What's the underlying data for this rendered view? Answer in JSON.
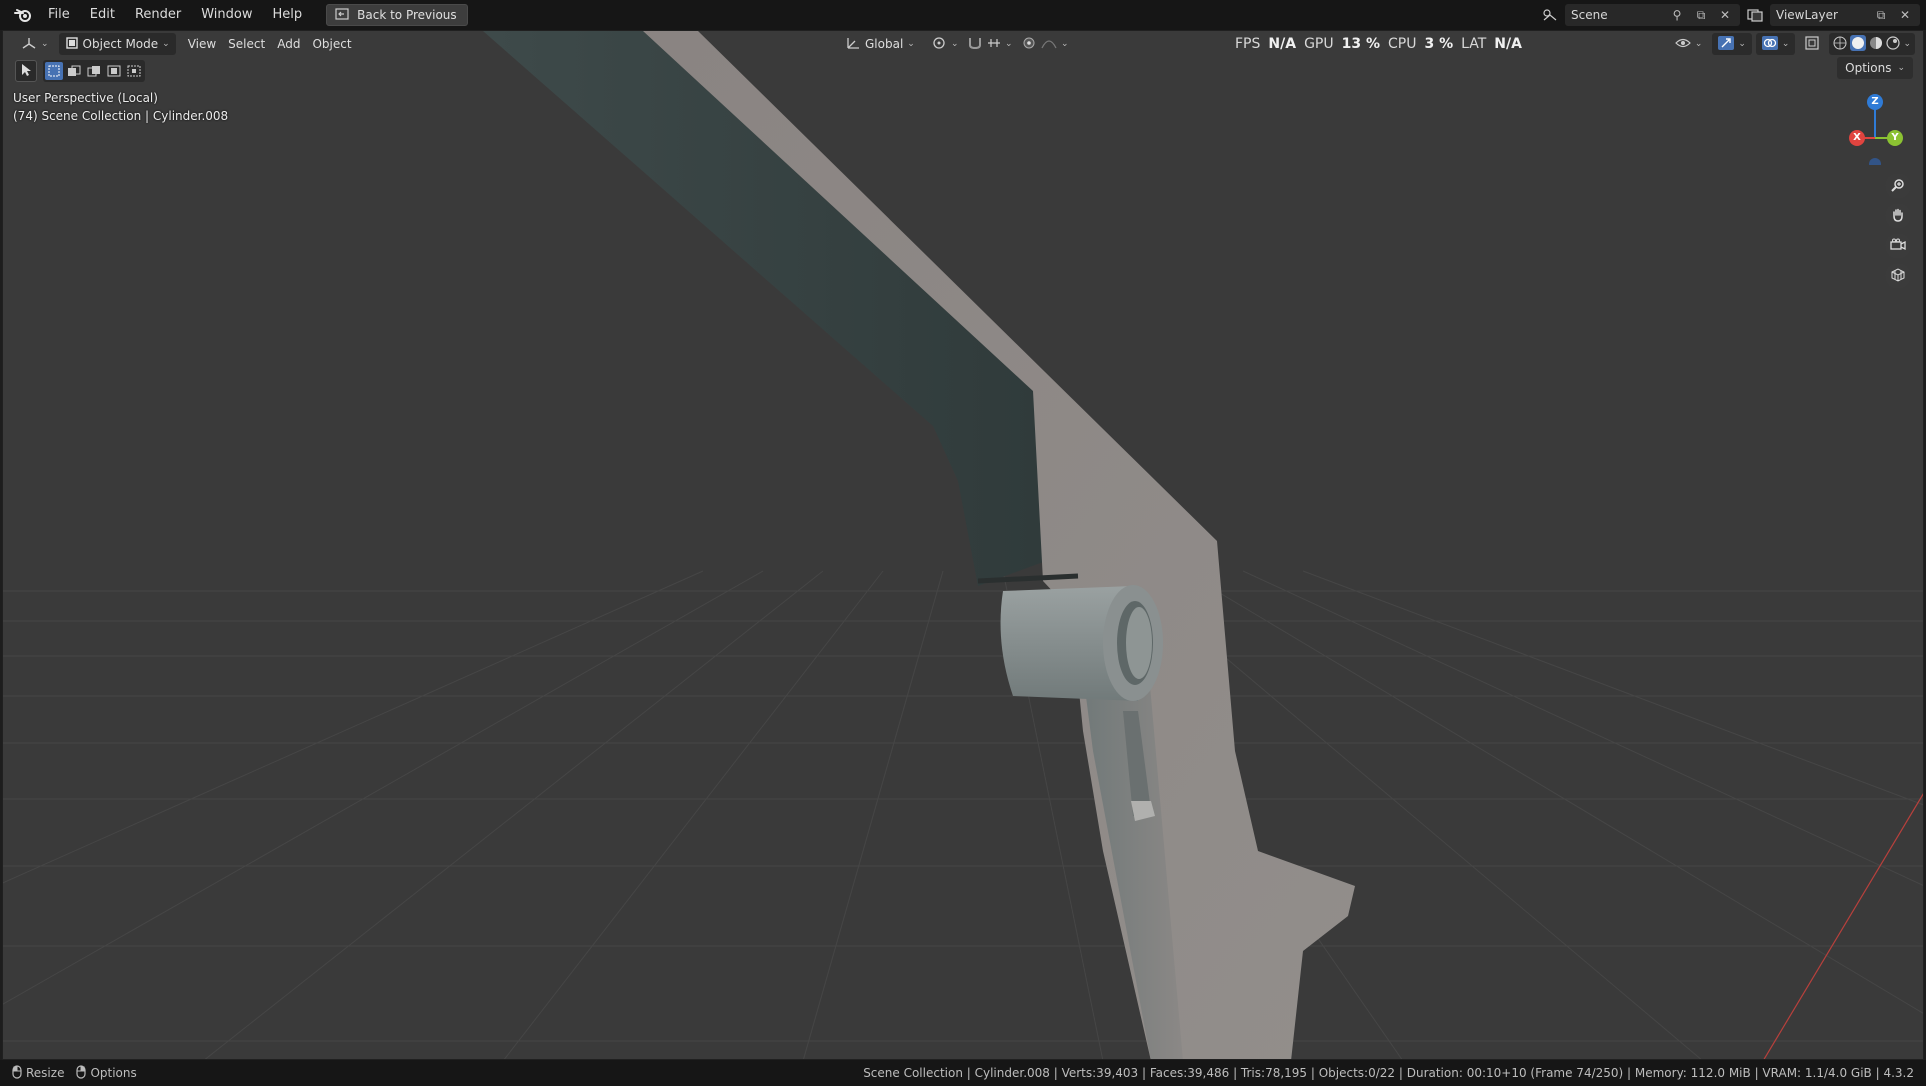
{
  "menu": {
    "items": [
      "File",
      "Edit",
      "Render",
      "Window",
      "Help"
    ],
    "back_button": "Back to Previous"
  },
  "scene": {
    "label": "Scene"
  },
  "view_layer": {
    "label": "ViewLayer"
  },
  "viewport_header": {
    "mode": "Object Mode",
    "menus": [
      "View",
      "Select",
      "Add",
      "Object"
    ],
    "orientation": "Global",
    "options_label": "Options"
  },
  "perf": {
    "fps_label": "FPS",
    "fps_value": "N/A",
    "gpu_label": "GPU",
    "gpu_value": "13 %",
    "cpu_label": "CPU",
    "cpu_value": "3 %",
    "lat_label": "LAT",
    "lat_value": "N/A"
  },
  "overlay": {
    "view_name": "User Perspective (Local)",
    "collection": "(74) Scene Collection | Cylinder.008"
  },
  "gizmo": {
    "z": "Z",
    "x": "X",
    "y": "Y"
  },
  "statusbar": {
    "resize": "Resize",
    "options": "Options",
    "info": "Scene Collection | Cylinder.008 | Verts:39,403 | Faces:39,486 | Tris:78,195 | Objects:0/22 | Duration: 00:10+10 (Frame 74/250) | Memory: 112.0 MiB | VRAM: 1.1/4.0 GiB | 4.3.2"
  },
  "colors": {
    "accent": "#4772b3",
    "axis_x": "#e0443f",
    "axis_y": "#8bc232",
    "axis_z": "#2f7bd6",
    "model": "#8d8987",
    "grid_bg": "#3a3a3a"
  },
  "icons": [
    "blender-logo-icon",
    "back-icon",
    "editor-type-icon",
    "object-mode-icon",
    "transform-global-icon",
    "pivot-icon",
    "snap-icon",
    "proportional-icon",
    "visibility-icon",
    "gizmo-icon",
    "overlay-icon",
    "xray-icon",
    "shading-wire-icon",
    "shading-solid-icon",
    "shading-material-icon",
    "shading-render-icon",
    "zoom-icon",
    "pan-hand-icon",
    "camera-icon",
    "ortho-grid-icon",
    "scene-icon",
    "pin-icon",
    "new-icon",
    "close-icon",
    "mouse-icon"
  ]
}
